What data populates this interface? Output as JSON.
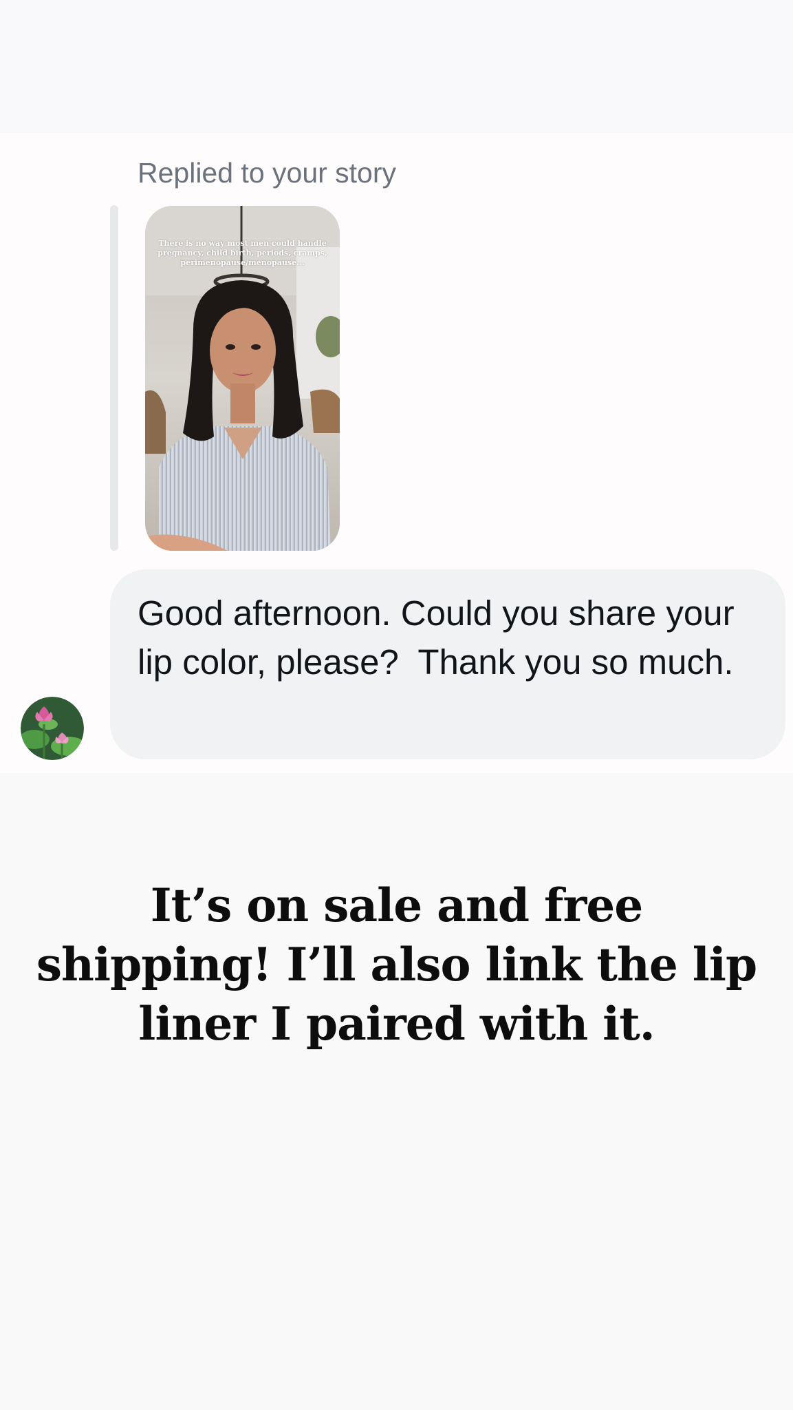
{
  "reply_context": {
    "label": "Replied to your story",
    "story_caption": "There is no way most men could handle pregnancy, child birth, periods, cramps, perimenopause/menopause..."
  },
  "message": {
    "text": "Good afternoon. Could you share your lip color, please?  Thank you so much."
  },
  "avatar": {
    "icon": "lotus-flower-avatar"
  },
  "overlay": {
    "headline": "It’s on sale and free shipping! I’ll also link the lip liner I paired with it."
  },
  "colors": {
    "bubble": "#f0f2f4",
    "label": "#6b727c",
    "headline": "#0d0d0d"
  }
}
